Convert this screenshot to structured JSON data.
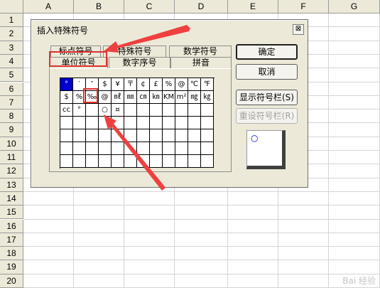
{
  "sheet": {
    "columns": [
      "A",
      "B",
      "C",
      "D",
      "E",
      "F",
      "G"
    ],
    "rows": [
      "1",
      "2",
      "3",
      "4",
      "5",
      "6",
      "7",
      "8",
      "9",
      "10",
      "11",
      "12",
      "13",
      "14",
      "15",
      "16",
      "17",
      "18",
      "19",
      "20"
    ]
  },
  "dialog": {
    "title": "插入特殊符号",
    "close_glyph": "⊠",
    "tabs": [
      "标点符号",
      "特殊符号",
      "数学符号",
      "单位符号",
      "数字序号",
      "拼音"
    ],
    "symbols": [
      [
        "°",
        "′",
        "″",
        "$",
        "¥",
        "〒",
        "¢",
        "£",
        "%",
        "@",
        "℃",
        "℉"
      ],
      [
        "$",
        "%",
        "‰",
        "@",
        "㎖",
        "㎜",
        "㎝",
        "㎞",
        "KM",
        "m²",
        "㎎",
        "㎏"
      ],
      [
        "cc",
        "°",
        "",
        "○",
        "¤",
        "",
        "",
        "",
        "",
        "",
        "",
        ""
      ]
    ],
    "buttons": {
      "ok": "确定",
      "cancel": "取消",
      "show_bar": "显示符号栏(S)",
      "reset_bar": "重设符号栏(R)"
    },
    "preview_glyph": "○"
  },
  "watermark": "Bai 经验"
}
